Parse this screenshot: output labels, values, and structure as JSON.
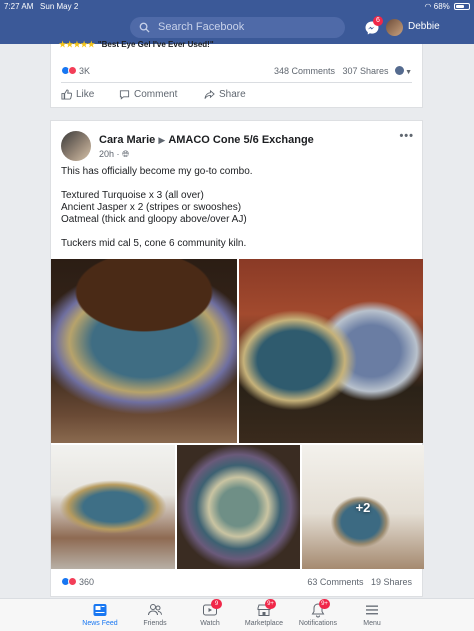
{
  "status_bar": {
    "time": "7:27 AM",
    "date": "Sun May 2",
    "battery": "68%",
    "battery_level": 0.68
  },
  "header": {
    "search_placeholder": "Search Facebook",
    "messenger_badge": "6",
    "user_name": "Debbie"
  },
  "ad_card": {
    "stars": "★★★★★",
    "headline": "\"Best Eye Gel I've Ever Used!\"",
    "reaction_count": "3K",
    "comments": "348 Comments",
    "shares": "307 Shares",
    "actions": {
      "like": "Like",
      "comment": "Comment",
      "share": "Share"
    }
  },
  "post": {
    "author": "Cara Marie",
    "group": "AMACO Cone 5/6 Exchange",
    "time": "20h",
    "text_lines": [
      "This has officially become my go-to combo.",
      "",
      "Textured Turquoise x 3 (all over)",
      "Ancient Jasper x 2 (stripes or swooshes)",
      "Oatmeal (thick and gloopy above/over AJ)",
      "",
      "Tuckers mid cal 5, cone 6 community kiln."
    ],
    "more_photos": "+2",
    "reaction_count": "360",
    "comments": "63 Comments",
    "shares": "19 Shares"
  },
  "tabs": [
    {
      "label": "News Feed",
      "icon": "news-feed-icon",
      "badge": ""
    },
    {
      "label": "Friends",
      "icon": "friends-icon",
      "badge": ""
    },
    {
      "label": "Watch",
      "icon": "watch-icon",
      "badge": "9"
    },
    {
      "label": "Marketplace",
      "icon": "marketplace-icon",
      "badge": "9+"
    },
    {
      "label": "Notifications",
      "icon": "bell-icon",
      "badge": "9+"
    },
    {
      "label": "Menu",
      "icon": "menu-icon",
      "badge": ""
    }
  ],
  "colors": {
    "brand": "#3b5998",
    "accent": "#1877f2",
    "badge": "#f02849"
  }
}
